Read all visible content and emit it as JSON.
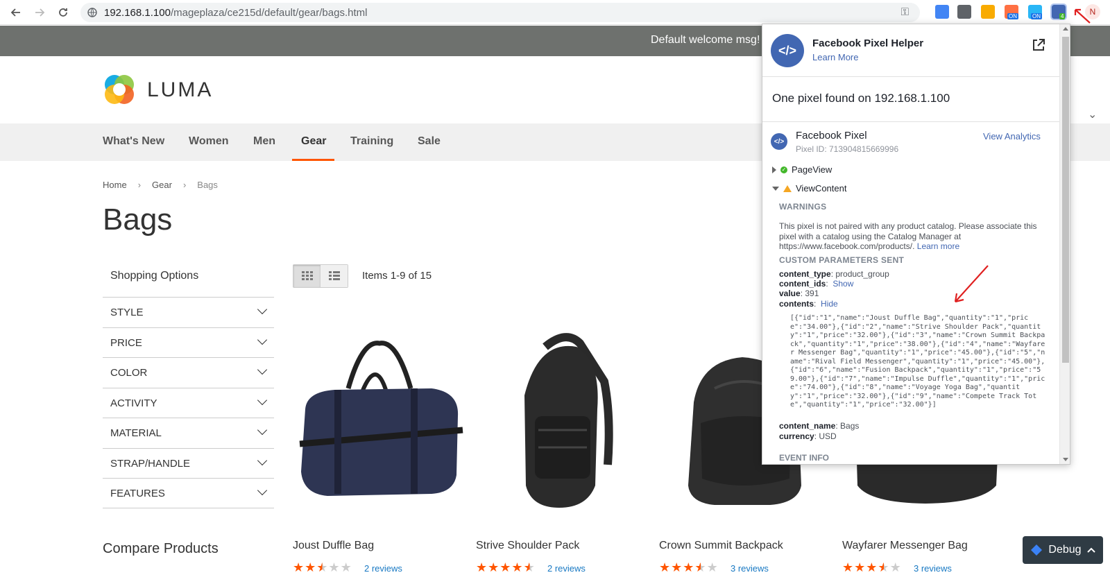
{
  "browser": {
    "url_host": "192.168.1.100",
    "url_path": "/mageplaza/ce215d/default/gear/bags.html",
    "avatar_letter": "N",
    "ext_badge_on": "ON",
    "ext_badge_count": "4"
  },
  "store": {
    "welcome": "Default welcome msg!",
    "logo_text": "LUMA"
  },
  "nav": {
    "items": [
      "What's New",
      "Women",
      "Men",
      "Gear",
      "Training",
      "Sale"
    ],
    "active": "Gear"
  },
  "breadcrumb": {
    "home": "Home",
    "gear": "Gear",
    "current": "Bags"
  },
  "page_title": "Bags",
  "sidebar": {
    "title": "Shopping Options",
    "filters": [
      "STYLE",
      "PRICE",
      "COLOR",
      "ACTIVITY",
      "MATERIAL",
      "STRAP/HANDLE",
      "FEATURES"
    ],
    "compare": "Compare Products"
  },
  "toolbar": {
    "amount": "Items 1-9 of 15"
  },
  "products": [
    {
      "name": "Joust Duffle Bag",
      "reviews": "2 reviews",
      "rating": 2.5
    },
    {
      "name": "Strive Shoulder Pack",
      "reviews": "2 reviews",
      "rating": 4.5
    },
    {
      "name": "Crown Summit Backpack",
      "reviews": "3 reviews",
      "rating": 3.5
    },
    {
      "name": "Wayfarer Messenger Bag",
      "reviews": "3 reviews",
      "rating": 3.5
    }
  ],
  "debug": {
    "label": "Debug"
  },
  "popup": {
    "title": "Facebook Pixel Helper",
    "learn_more": "Learn More",
    "found": "One pixel found on 192.168.1.100",
    "pixel_name": "Facebook Pixel",
    "pixel_id": "Pixel ID: 713904815669996",
    "view_analytics": "View Analytics",
    "event_pageview": "PageView",
    "event_viewcontent": "ViewContent",
    "warnings_heading": "WARNINGS",
    "warning_text": "This pixel is not paired with any product catalog. Please associate this pixel with a catalog using the Catalog Manager at https://www.facebook.com/products/.",
    "warning_learn_more": "Learn more",
    "params_heading": "CUSTOM PARAMETERS SENT",
    "params": {
      "content_type_key": "content_type",
      "content_type_val": "product_group",
      "content_ids_key": "content_ids",
      "content_ids_action": "Show",
      "value_key": "value",
      "value_val": "391",
      "contents_key": "contents",
      "contents_action": "Hide",
      "contents_json": "[{\"id\":\"1\",\"name\":\"Joust Duffle Bag\",\"quantity\":\"1\",\"price\":\"34.00\"},{\"id\":\"2\",\"name\":\"Strive Shoulder Pack\",\"quantity\":\"1\",\"price\":\"32.00\"},{\"id\":\"3\",\"name\":\"Crown Summit Backpack\",\"quantity\":\"1\",\"price\":\"38.00\"},{\"id\":\"4\",\"name\":\"Wayfarer Messenger Bag\",\"quantity\":\"1\",\"price\":\"45.00\"},{\"id\":\"5\",\"name\":\"Rival Field Messenger\",\"quantity\":\"1\",\"price\":\"45.00\"},{\"id\":\"6\",\"name\":\"Fusion Backpack\",\"quantity\":\"1\",\"price\":\"59.00\"},{\"id\":\"7\",\"name\":\"Impulse Duffle\",\"quantity\":\"1\",\"price\":\"74.00\"},{\"id\":\"8\",\"name\":\"Voyage Yoga Bag\",\"quantity\":\"1\",\"price\":\"32.00\"},{\"id\":\"9\",\"name\":\"Compete Track Tote\",\"quantity\":\"1\",\"price\":\"32.00\"}]",
      "content_name_key": "content_name",
      "content_name_val": "Bags",
      "currency_key": "currency",
      "currency_val": "USD"
    },
    "event_info_heading": "EVENT INFO"
  },
  "colors": {
    "accent": "#ff5501",
    "facebook_blue": "#4267b2",
    "link_blue": "#1979c3",
    "welcome_bar": "#6e716e"
  },
  "icons": {
    "back": "arrow-left-icon",
    "forward": "arrow-right-icon",
    "reload": "reload-icon",
    "site_info": "site-info-icon",
    "key": "key-icon",
    "open_external": "external-link-icon"
  }
}
